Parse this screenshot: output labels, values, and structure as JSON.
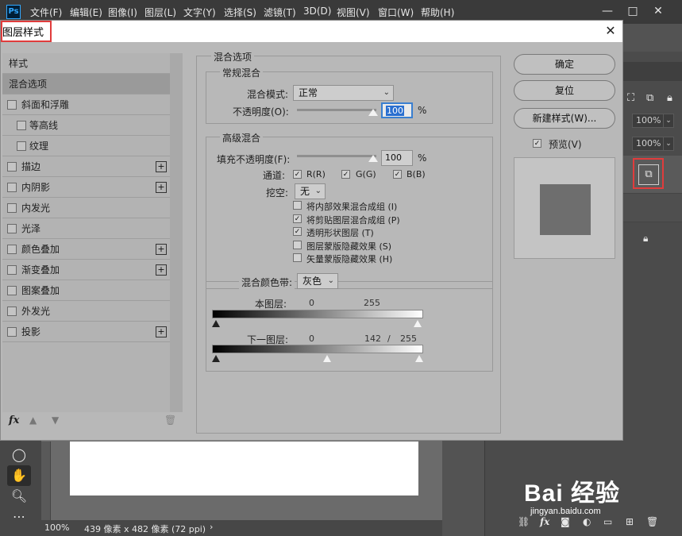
{
  "app": {
    "logo": "Ps",
    "menu": [
      "文件(F)",
      "编辑(E)",
      "图像(I)",
      "图层(L)",
      "文字(Y)",
      "选择(S)",
      "滤镜(T)",
      "3D(D)",
      "视图(V)",
      "窗口(W)",
      "帮助(H)"
    ],
    "window_controls": [
      "—",
      "□",
      "✕"
    ],
    "zoom": "100%",
    "doc_info": "439 像素 x 482 像素 (72 ppi)",
    "status_arrow": "›",
    "panel_fields": [
      "100%",
      "100%"
    ],
    "layers_footer_icons": [
      "link-icon",
      "fx-icon",
      "mask-icon",
      "adjustment-icon",
      "folder-icon",
      "new-layer-icon",
      "trash-icon"
    ]
  },
  "dialog": {
    "title": "图层样式",
    "close": "✕",
    "style_list": {
      "header": "样式",
      "items": [
        {
          "label": "混合选项",
          "selected": true,
          "checkbox": false,
          "indent": false,
          "plus": false
        },
        {
          "label": "斜面和浮雕",
          "checkbox": true,
          "indent": false,
          "plus": false
        },
        {
          "label": "等高线",
          "checkbox": true,
          "indent": true,
          "plus": false
        },
        {
          "label": "纹理",
          "checkbox": true,
          "indent": true,
          "plus": false
        },
        {
          "label": "描边",
          "checkbox": true,
          "indent": false,
          "plus": true
        },
        {
          "label": "内阴影",
          "checkbox": true,
          "indent": false,
          "plus": true
        },
        {
          "label": "内发光",
          "checkbox": true,
          "indent": false,
          "plus": false
        },
        {
          "label": "光泽",
          "checkbox": true,
          "indent": false,
          "plus": false
        },
        {
          "label": "颜色叠加",
          "checkbox": true,
          "indent": false,
          "plus": true
        },
        {
          "label": "渐变叠加",
          "checkbox": true,
          "indent": false,
          "plus": true
        },
        {
          "label": "图案叠加",
          "checkbox": true,
          "indent": false,
          "plus": false
        },
        {
          "label": "外发光",
          "checkbox": true,
          "indent": false,
          "plus": false
        },
        {
          "label": "投影",
          "checkbox": true,
          "indent": false,
          "plus": true
        }
      ],
      "footer_fx": "fx"
    },
    "blend": {
      "section_title": "混合选项",
      "general_title": "常规混合",
      "mode_label": "混合模式:",
      "mode_value": "正常",
      "opacity_label": "不透明度(O):",
      "opacity_value": "100",
      "percent": "%",
      "advanced_title": "高级混合",
      "fill_label": "填充不透明度(F):",
      "fill_value": "100",
      "channels_label": "通道:",
      "channels": [
        {
          "label": "R(R)",
          "checked": true
        },
        {
          "label": "G(G)",
          "checked": true
        },
        {
          "label": "B(B)",
          "checked": true
        }
      ],
      "knockout_label": "挖空:",
      "knockout_value": "无",
      "options": [
        {
          "label": "将内部效果混合成组 (I)",
          "checked": false
        },
        {
          "label": "将剪贴图层混合成组 (P)",
          "checked": true
        },
        {
          "label": "透明形状图层 (T)",
          "checked": true
        },
        {
          "label": "图层蒙版隐藏效果 (S)",
          "checked": false
        },
        {
          "label": "矢量蒙版隐藏效果 (H)",
          "checked": false
        }
      ],
      "blend_if_label": "混合颜色带:",
      "blend_if_value": "灰色",
      "this_layer_label": "本图层:",
      "this_layer_values": [
        "0",
        "255"
      ],
      "underlying_label": "下一图层:",
      "underlying_values": [
        "0",
        "142",
        "/",
        "255"
      ]
    },
    "buttons": {
      "ok": "确定",
      "reset": "复位",
      "new_style": "新建样式(W)...",
      "preview_label": "预览(V)",
      "preview_checked": true
    },
    "preview_swatch_color": "#6e6e6e"
  },
  "watermark": {
    "text": "Bai 经验",
    "url": "jingyan.baidu.com"
  }
}
